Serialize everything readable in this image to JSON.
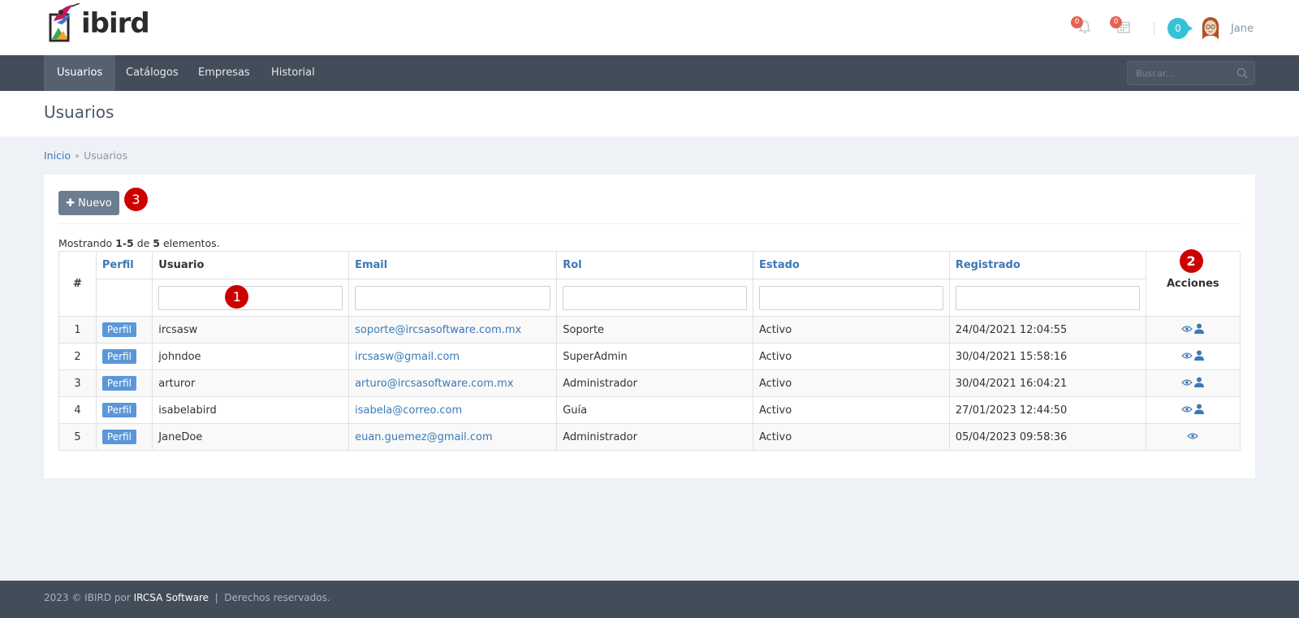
{
  "header": {
    "logo_text": "ibird",
    "notifications_count": "0",
    "calendar_count": "0",
    "messages_count": "0",
    "user_name": "Jane"
  },
  "nav": {
    "items": [
      "Usuarios",
      "Catálogos",
      "Empresas",
      "Historial"
    ],
    "active": "Usuarios",
    "search_placeholder": "Buscar..."
  },
  "page": {
    "title": "Usuarios",
    "breadcrumb": [
      "Inicio",
      "Usuarios"
    ]
  },
  "toolbar": {
    "new_label": "Nuevo"
  },
  "markers": [
    "1",
    "2",
    "3"
  ],
  "summary": {
    "prefix": "Mostrando ",
    "range": "1-5",
    "middle": " de ",
    "total": "5",
    "suffix": " elementos."
  },
  "table": {
    "headers": {
      "num": "#",
      "perfil": "Perfil",
      "usuario": "Usuario",
      "email": "Email",
      "rol": "Rol",
      "estado": "Estado",
      "registrado": "Registrado",
      "acciones": "Acciones"
    },
    "perfil_label": "Perfil",
    "rows": [
      {
        "num": "1",
        "usuario": "ircsasw",
        "email": "soporte@ircsasoftware.com.mx",
        "rol": "Soporte",
        "estado": "Activo",
        "registrado": "24/04/2021 12:04:55"
      },
      {
        "num": "2",
        "usuario": "johndoe",
        "email": "ircsasw@gmail.com",
        "rol": "SuperAdmin",
        "estado": "Activo",
        "registrado": "30/04/2021 15:58:16"
      },
      {
        "num": "3",
        "usuario": "arturor",
        "email": "arturo@ircsasoftware.com.mx",
        "rol": "Administrador",
        "estado": "Activo",
        "registrado": "30/04/2021 16:04:21"
      },
      {
        "num": "4",
        "usuario": "isabelabird",
        "email": "isabela@correo.com",
        "rol": "Guía",
        "estado": "Activo",
        "registrado": "27/01/2023 12:44:50"
      },
      {
        "num": "5",
        "usuario": "JaneDoe",
        "email": "euan.guemez@gmail.com",
        "rol": "Administrador",
        "estado": "Activo",
        "registrado": "05/04/2023 09:58:36"
      }
    ]
  },
  "footer": {
    "prefix": "2023 © IBIRD por ",
    "company": "IRCSA Software",
    "suffix": "  |  Derechos reservados."
  },
  "colors": {
    "nav_bg": "#434c59",
    "accent_link": "#3c79b5",
    "marker_red": "#cc0000",
    "perfil_blue": "#5a97d8",
    "badge_red": "#e8614f",
    "bubble_cyan": "#35c1d6"
  }
}
